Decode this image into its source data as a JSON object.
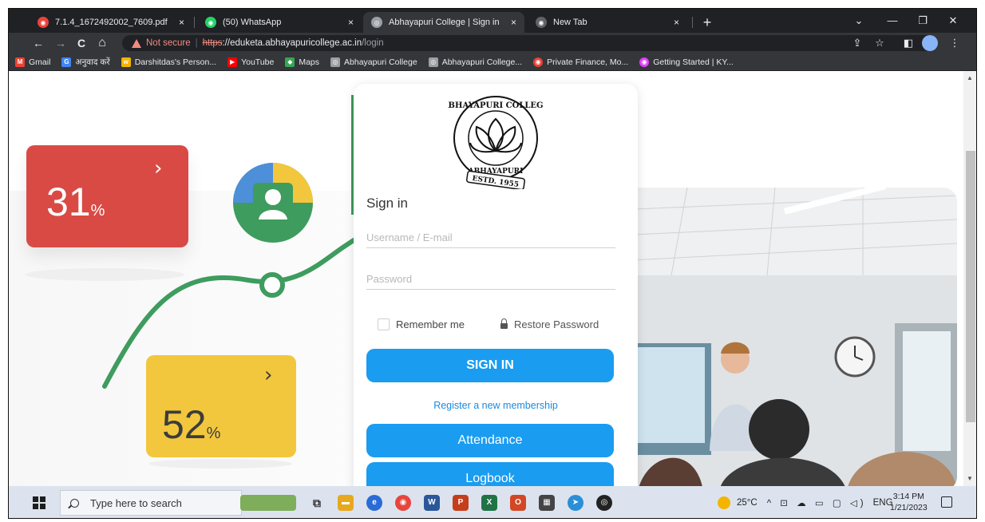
{
  "browser": {
    "tabs": [
      {
        "title": "7.1.4_1672492002_7609.pdf",
        "close": "×",
        "active": false
      },
      {
        "title": "(50) WhatsApp",
        "close": "×",
        "active": false
      },
      {
        "title": "Abhayapuri College | Sign in",
        "close": "×",
        "active": true
      },
      {
        "title": "New Tab",
        "close": "×",
        "active": false
      }
    ],
    "new_tab": "+",
    "window_controls": {
      "dropdown": "⌄",
      "minimize": "—",
      "restore": "❐",
      "close": "✕"
    },
    "nav": {
      "back": "←",
      "forward": "→",
      "reload": "C",
      "home": "⌂"
    },
    "omnibox": {
      "security_label": "Not secure",
      "separator": "|",
      "url_scheme": "https",
      "url_host": "://eduketa.abhayapuricollege.ac.in",
      "url_path": "/login"
    },
    "bookmarks": [
      {
        "label": "Gmail",
        "icon": "gmail-icon",
        "color": "#ea4335",
        "glyph": "M"
      },
      {
        "label": "अनुवाद करें",
        "icon": "translate-icon",
        "color": "#4285f4",
        "glyph": "G"
      },
      {
        "label": "Darshitdas's Person...",
        "icon": "wordpress-icon",
        "color": "#f4b400",
        "glyph": "w"
      },
      {
        "label": "YouTube",
        "icon": "youtube-icon",
        "color": "#ff0000",
        "glyph": "▶"
      },
      {
        "label": "Maps",
        "icon": "maps-icon",
        "color": "#34a853",
        "glyph": "◆"
      },
      {
        "label": "Abhayapuri College",
        "icon": "globe-icon",
        "color": "#9aa0a6",
        "glyph": "◎"
      },
      {
        "label": "Abhayapuri College...",
        "icon": "college-icon",
        "color": "#9aa0a6",
        "glyph": "◎"
      },
      {
        "label": "Private Finance, Mo...",
        "icon": "finance-icon",
        "color": "#e94235",
        "glyph": "◉"
      },
      {
        "label": "Getting Started | KY...",
        "icon": "kyc-icon",
        "color": "#e040fb",
        "glyph": "◉"
      }
    ]
  },
  "page": {
    "stat_cards": [
      {
        "value": "31",
        "unit": "%",
        "chevron": "›",
        "color": "#d94a44"
      },
      {
        "value": "52",
        "unit": "%",
        "chevron": "›",
        "color": "#f2c73d"
      }
    ],
    "login": {
      "logo_text_top": "ABHAYAPURI COLLEGE",
      "logo_text_bottom": "ABHAYAPURI",
      "logo_estd": "ESTD. 1955",
      "title": "Sign in",
      "username_placeholder": "Username / E-mail",
      "password_placeholder": "Password",
      "remember_label": "Remember me",
      "restore_label": "Restore Password",
      "signin_button": "SIGN IN",
      "register_link": "Register a new membership",
      "attendance_button": "Attendance",
      "logbook_button": "Logbook",
      "accent_color": "#1a9cf0"
    }
  },
  "taskbar": {
    "search_placeholder": "Type here to search",
    "weather": "25°C",
    "language": "ENG",
    "time": "3:14 PM",
    "date": "1/21/2023",
    "tray_icons": "^ ⊡ ☁ ▭ ▢ ◁)"
  }
}
